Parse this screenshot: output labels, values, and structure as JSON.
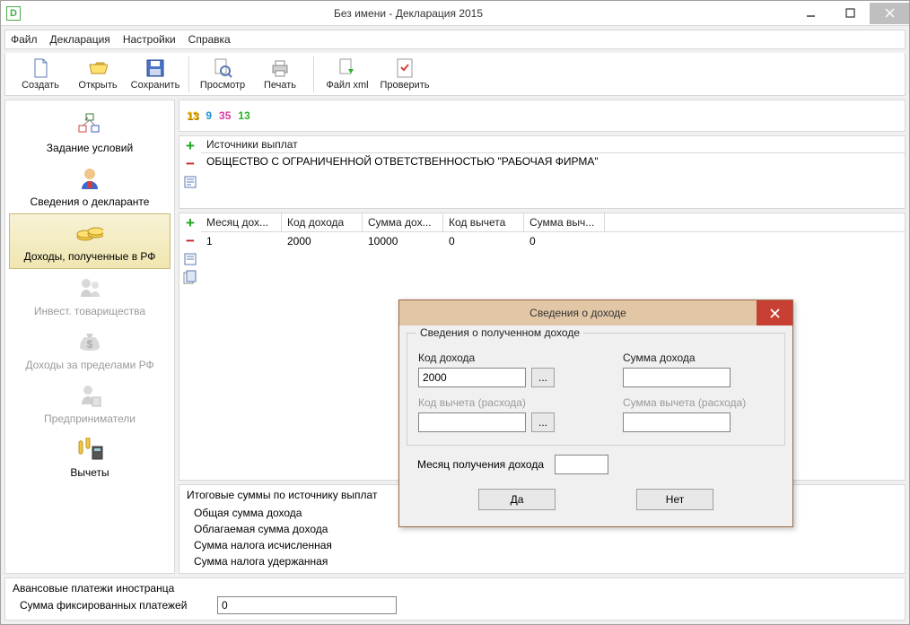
{
  "window": {
    "title": "Без имени - Декларация 2015",
    "icon_letter": "D"
  },
  "menu": {
    "file": "Файл",
    "declaration": "Декларация",
    "settings": "Настройки",
    "help": "Справка"
  },
  "toolbar": {
    "new": "Создать",
    "open": "Открыть",
    "save": "Сохранить",
    "preview": "Просмотр",
    "print": "Печать",
    "xml": "Файл xml",
    "check": "Проверить"
  },
  "numbar": {
    "a": "13",
    "b": "9",
    "c": "35",
    "d": "13"
  },
  "sidebar": {
    "conditions": "Задание условий",
    "declarant": "Сведения о декларанте",
    "incomes_rf": "Доходы, полученные в РФ",
    "invest": "Инвест. товарищества",
    "abroad": "Доходы за пределами РФ",
    "entrepreneur": "Предприниматели",
    "deductions": "Вычеты"
  },
  "sources": {
    "header": "Источники выплат",
    "rows": [
      "ОБЩЕСТВО С ОГРАНИЧЕННОЙ ОТВЕТСТВЕННОСТЬЮ \"РАБОЧАЯ ФИРМА\""
    ]
  },
  "table": {
    "headers": [
      "Месяц дох...",
      "Код дохода",
      "Сумма дох...",
      "Код вычета",
      "Сумма выч..."
    ],
    "rows": [
      [
        "1",
        "2000",
        "10000",
        "0",
        "0"
      ]
    ]
  },
  "totals": {
    "header": "Итоговые суммы по источнику выплат",
    "total_income": "Общая сумма дохода",
    "taxable_income": "Облагаемая сумма дохода",
    "tax_calculated": "Сумма налога исчисленная",
    "tax_withheld": "Сумма налога удержанная"
  },
  "advance": {
    "header": "Авансовые платежи иностранца",
    "fixed": "Сумма фиксированных платежей",
    "value": "0"
  },
  "dialog": {
    "title": "Сведения о доходе",
    "group": "Сведения о полученном доходе",
    "code_label": "Код дохода",
    "code_value": "2000",
    "amount_label": "Сумма дохода",
    "ded_code_label": "Код вычета (расхода)",
    "ded_amount_label": "Сумма вычета (расхода)",
    "month_label": "Месяц получения дохода",
    "yes": "Да",
    "no": "Нет",
    "ellipsis": "..."
  }
}
